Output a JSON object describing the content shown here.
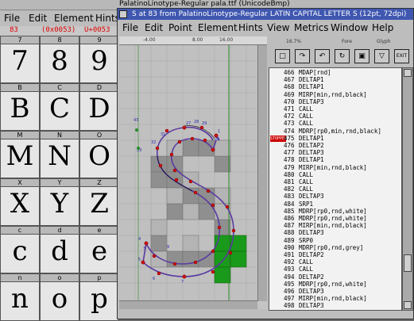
{
  "font_window": {
    "title": "PalatinoLinotype-Regular  pala.ttf (UnicodeBmp)",
    "menu": [
      "File",
      "Edit",
      "Element",
      "Hints"
    ],
    "info": {
      "code": "83",
      "hex": "(0x0053)",
      "unicode": "U+0053"
    },
    "rows": [
      {
        "labels": [
          "7",
          "8",
          "9"
        ],
        "glyphs": [
          "7",
          "8",
          "9"
        ]
      },
      {
        "labels": [
          "B",
          "C",
          "D"
        ],
        "glyphs": [
          "B",
          "C",
          "D"
        ]
      },
      {
        "labels": [
          "M",
          "N",
          "O"
        ],
        "glyphs": [
          "M",
          "N",
          "O"
        ]
      },
      {
        "labels": [
          "X",
          "Y",
          "Z"
        ],
        "glyphs": [
          "X",
          "Y",
          "Z"
        ]
      },
      {
        "labels": [
          "c",
          "d",
          "e"
        ],
        "glyphs": [
          "c",
          "d",
          "e"
        ]
      },
      {
        "labels": [
          "n",
          "o",
          "p"
        ],
        "glyphs": [
          "n",
          "o",
          "p"
        ]
      }
    ]
  },
  "glyph_window": {
    "title": "S at 83 from PalatinoLinotype-Regular LATIN CAPITAL LETTER S (12pt, 72dpi)",
    "menu": [
      "File",
      "Edit",
      "Point",
      "Element",
      "Hints",
      "View",
      "Metrics",
      "Window",
      "Help"
    ],
    "ruler": [
      "-4.00",
      "8.00",
      "16.00"
    ],
    "status": {
      "size": "16.7%",
      "label1": "Fore",
      "label2": "Glyph"
    },
    "toolbar": [
      "□",
      "↷",
      "↶",
      "↻",
      "▽",
      "EXIT"
    ],
    "current_marker": "STOPPED",
    "instructions": [
      {
        "num": "466",
        "op": "MDAP[rnd]"
      },
      {
        "num": "467",
        "op": "DELTAP1"
      },
      {
        "num": "468",
        "op": "DELTAP1"
      },
      {
        "num": "469",
        "op": "MIRP[min,rnd,black]"
      },
      {
        "num": "470",
        "op": "DELTAP3"
      },
      {
        "num": "471",
        "op": "CALL"
      },
      {
        "num": "472",
        "op": "CALL"
      },
      {
        "num": "473",
        "op": "CALL"
      },
      {
        "num": "474",
        "op": "MDRP[rp0,min,rnd,black]"
      },
      {
        "num": "475",
        "op": "DELTAP1"
      },
      {
        "num": "476",
        "op": "DELTAP2"
      },
      {
        "num": "477",
        "op": "DELTAP3"
      },
      {
        "num": "478",
        "op": "DELTAP1"
      },
      {
        "num": "479",
        "op": "MIRP[min,rnd,black]"
      },
      {
        "num": "480",
        "op": "CALL"
      },
      {
        "num": "481",
        "op": "CALL"
      },
      {
        "num": "482",
        "op": "CALL"
      },
      {
        "num": "483",
        "op": "DELTAP3"
      },
      {
        "num": "484",
        "op": "SRP1"
      },
      {
        "num": "485",
        "op": "MDRP[rp0,rnd,white]"
      },
      {
        "num": "486",
        "op": "MDRP[rp0,rnd,white]"
      },
      {
        "num": "487",
        "op": "MIRP[min,rnd,black]"
      },
      {
        "num": "488",
        "op": "DELTAP3"
      },
      {
        "num": "489",
        "op": "SRP0"
      },
      {
        "num": "490",
        "op": "MDRP[rp0,rnd,grey]"
      },
      {
        "num": "491",
        "op": "DELTAP2"
      },
      {
        "num": "492",
        "op": "CALL"
      },
      {
        "num": "493",
        "op": "CALL"
      },
      {
        "num": "494",
        "op": "DELTAP2"
      },
      {
        "num": "495",
        "op": "MDRP[rp0,rnd,white]"
      },
      {
        "num": "496",
        "op": "DELTAP3"
      },
      {
        "num": "497",
        "op": "MIRP[min,rnd,black]"
      },
      {
        "num": "498",
        "op": "DELTAP3"
      }
    ],
    "current_index": 9
  }
}
